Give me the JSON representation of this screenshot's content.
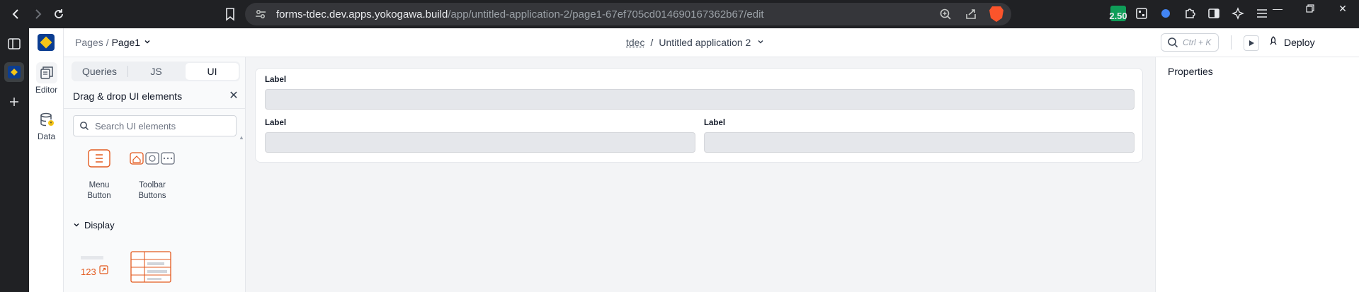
{
  "browser": {
    "url_host": "forms-tdec.dev.apps.yokogawa.build",
    "url_path": "/app/untitled-application-2/page1-67ef705cd014690167362b67/edit",
    "extension_badge": "2.50",
    "icons": [
      "back-icon",
      "forward-icon",
      "reload-icon",
      "bookmark-icon",
      "site-settings-icon",
      "zoom-icon",
      "share-icon",
      "brave-shield-icon"
    ]
  },
  "app_rail": {
    "items": [
      {
        "label": "Editor",
        "icon": "editor-icon"
      },
      {
        "label": "Data",
        "icon": "database-icon"
      }
    ]
  },
  "header": {
    "breadcrumb_root": "Pages",
    "breadcrumb_sep": "/",
    "breadcrumb_page": "Page1",
    "workspace": "tdec",
    "center_sep": "/",
    "app_name": "Untitled application 2",
    "search_shortcut": "Ctrl + K",
    "deploy_label": "Deploy"
  },
  "sidebar": {
    "tabs": [
      {
        "label": "Queries",
        "active": false
      },
      {
        "label": "JS",
        "active": false
      },
      {
        "label": "UI",
        "active": true
      }
    ],
    "panel_title": "Drag & drop UI elements",
    "search_placeholder": "Search UI elements",
    "widgets": [
      {
        "line1": "Menu",
        "line2": "Button"
      },
      {
        "line1": "Toolbar",
        "line2": "Buttons"
      }
    ],
    "section_display": "Display",
    "stat_preview_text": "123"
  },
  "canvas": {
    "fields": [
      {
        "label": "Label"
      },
      {
        "label": "Label"
      },
      {
        "label": "Label"
      }
    ]
  },
  "properties": {
    "title": "Properties"
  },
  "colors": {
    "accent_orange": "#e35a1f",
    "brand_navy": "#0b3d91",
    "brand_yellow": "#f5c518"
  }
}
